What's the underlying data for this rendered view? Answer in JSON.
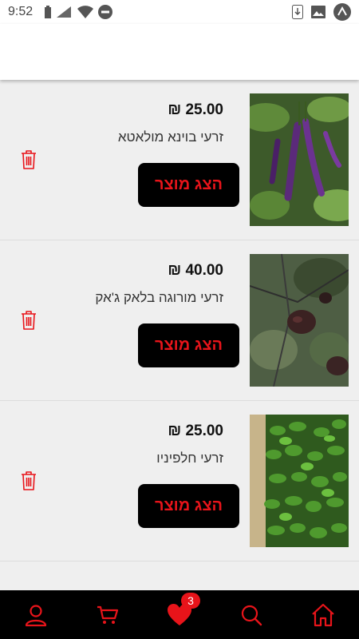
{
  "status_bar": {
    "time": "9:52"
  },
  "products": [
    {
      "price": "25.00 ₪",
      "name": "זרעי בוינא מולאטא",
      "button_label": "הצג מוצר",
      "image": "purple-pepper-plant"
    },
    {
      "price": "40.00 ₪",
      "name": "זרעי מורוגה בלאק ג'אק",
      "button_label": "הצג מוצר",
      "image": "dark-wrinkled-pepper"
    },
    {
      "price": "25.00 ₪",
      "name": "זרעי חלפיניו",
      "button_label": "הצג מוצר",
      "image": "green-jalapeno-pile"
    }
  ],
  "tab_bar": {
    "items": [
      "profile-icon",
      "cart-icon",
      "heart-icon",
      "search-icon",
      "home-icon"
    ],
    "favorites_badge": "3",
    "accent_color": "#e8141a"
  }
}
